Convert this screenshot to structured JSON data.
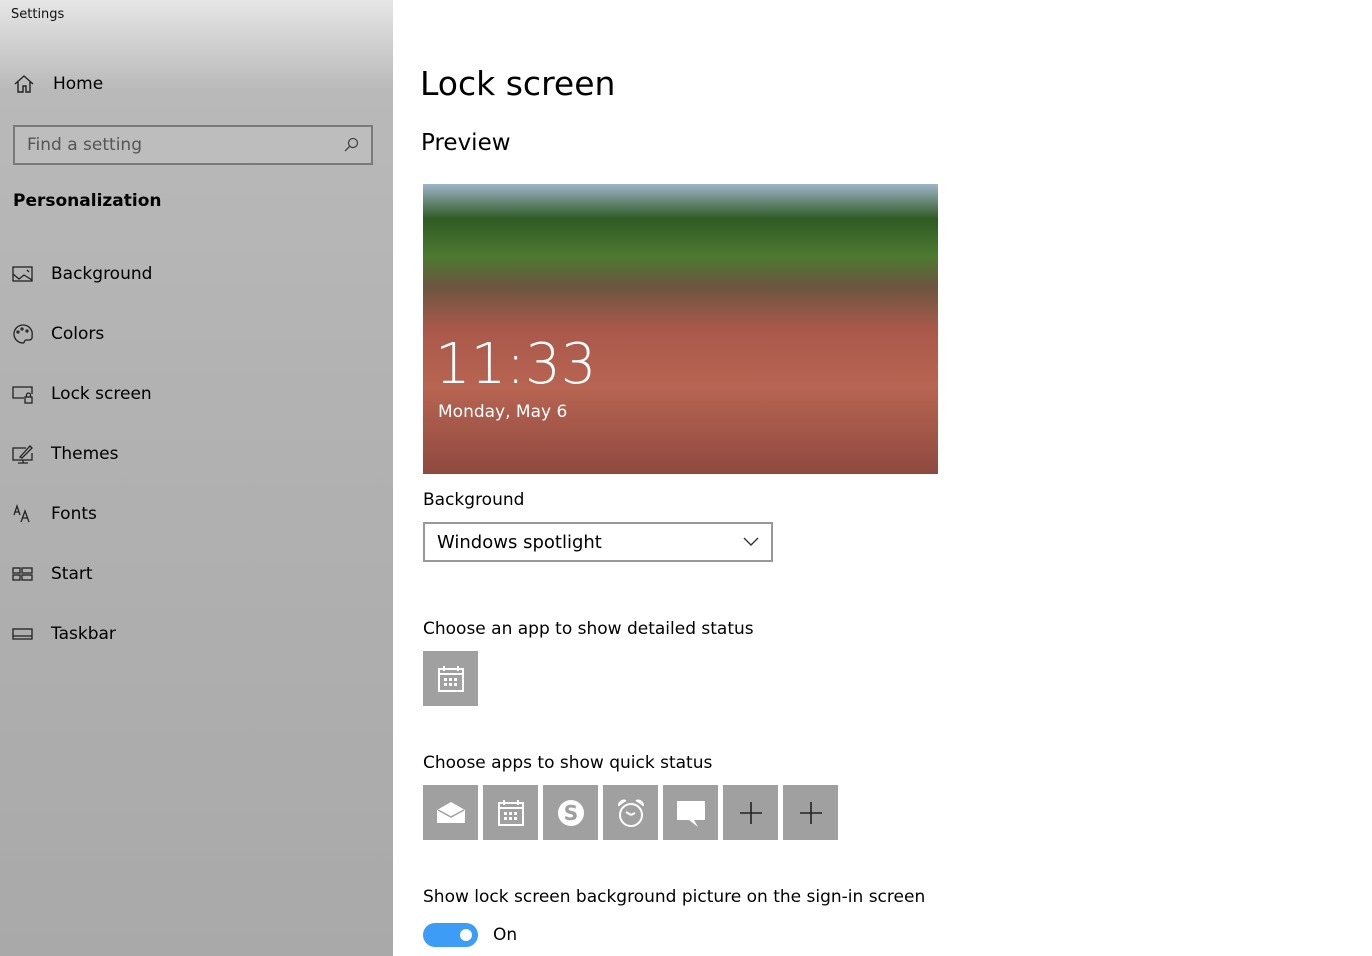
{
  "app_title": "Settings",
  "sidebar": {
    "home": "Home",
    "search_placeholder": "Find a setting",
    "category": "Personalization",
    "items": [
      {
        "label": "Background",
        "icon": "picture-icon"
      },
      {
        "label": "Colors",
        "icon": "palette-icon"
      },
      {
        "label": "Lock screen",
        "icon": "lock-screen-icon"
      },
      {
        "label": "Themes",
        "icon": "themes-icon"
      },
      {
        "label": "Fonts",
        "icon": "fonts-icon"
      },
      {
        "label": "Start",
        "icon": "start-icon"
      },
      {
        "label": "Taskbar",
        "icon": "taskbar-icon"
      }
    ]
  },
  "main": {
    "title": "Lock screen",
    "preview_heading": "Preview",
    "preview_time": "11:33",
    "preview_date": "Monday, May 6",
    "background_label": "Background",
    "background_value": "Windows spotlight",
    "detailed_label": "Choose an app to show detailed status",
    "detailed_app": "calendar-icon",
    "quick_label": "Choose apps to show quick status",
    "quick_apps": [
      "mail-icon",
      "calendar-icon",
      "skype-icon",
      "alarm-icon",
      "message-icon",
      "plus-icon",
      "plus-icon"
    ],
    "signin_label": "Show lock screen background picture on the sign-in screen",
    "signin_state": "On",
    "toggle_color": "#3d9cf5"
  }
}
